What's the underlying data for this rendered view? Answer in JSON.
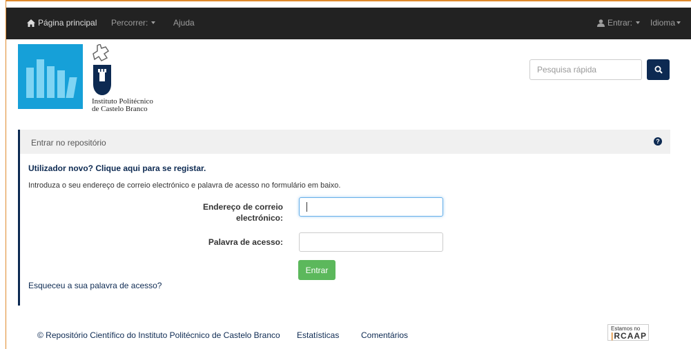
{
  "navbar": {
    "home_label": "Página principal",
    "browse_label": "Percorrer:",
    "help_label": "Ajuda",
    "login_label": "Entrar:",
    "language_label": "Idioma"
  },
  "header": {
    "institution_line1": "Instituto Politécnico",
    "institution_line2": "de Castelo Branco",
    "search_placeholder": "Pesquisa rápida"
  },
  "panel": {
    "title": "Entrar no repositório",
    "register_link": "Utilizador novo? Clique aqui para se registar.",
    "intro": "Introduza o seu endereço de correio electrónico e palavra de acesso no formulário em baixo.",
    "email_label_line1": "Endereço de correio",
    "email_label_line2": "electrónico:",
    "email_value": "",
    "password_label": "Palavra de acesso:",
    "password_value": "",
    "submit_label": "Entrar",
    "forgot_link": "Esqueceu a sua palavra de acesso?"
  },
  "footer": {
    "copyright": "© Repositório Científico do Instituto Politécnico de Castelo Branco",
    "stats": "Estatísticas",
    "comments": "Comentários",
    "badge_small": "Estamos no",
    "badge_big": "RCAAP"
  },
  "colors": {
    "navbar_bg": "#222222",
    "brand_dark": "#0d2a52",
    "button_green": "#5cb85c",
    "frame_orange": "#e08a2c",
    "logo_blue": "#16a0d8"
  }
}
